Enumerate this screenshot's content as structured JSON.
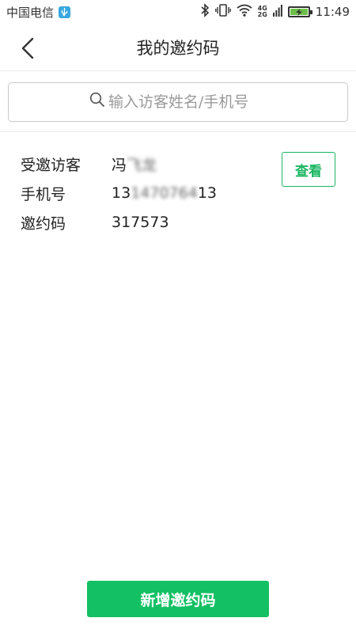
{
  "status_bar": {
    "carrier": "中国电信",
    "network_top": "4G",
    "network_bottom": "2G",
    "time": "11:49"
  },
  "nav": {
    "title": "我的邀约码"
  },
  "search": {
    "placeholder": "输入访客姓名/手机号",
    "value": ""
  },
  "invite": {
    "visitor_label": "受邀访客",
    "visitor_name_visible": "冯",
    "visitor_name_blurred": "飞龙",
    "phone_label": "手机号",
    "phone_prefix": "13",
    "phone_blurred": "1470764",
    "phone_suffix": "13",
    "code_label": "邀约码",
    "code_value": "317573",
    "view_button": "查看"
  },
  "footer": {
    "add_button": "新增邀约码"
  },
  "colors": {
    "accent_green": "#13c063",
    "border_green": "#1bb661",
    "usb_badge": "#3aa7e0",
    "battery_fill": "#6cc04a"
  }
}
